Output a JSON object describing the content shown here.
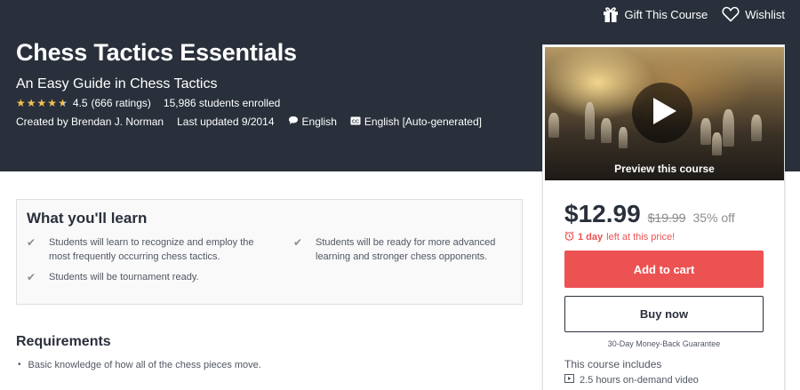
{
  "top_actions": {
    "gift_label": "Gift This Course",
    "wishlist_label": "Wishlist"
  },
  "course": {
    "title": "Chess Tactics Essentials",
    "subtitle": "An Easy Guide in Chess Tactics",
    "rating_value": "4.5",
    "rating_fraction": 0.9,
    "rating_count": "(666 ratings)",
    "enrolled": "15,986 students enrolled",
    "created_by": "Created by Brendan J. Norman",
    "last_updated": "Last updated 9/2014",
    "language": "English",
    "captions": "English [Auto-generated]"
  },
  "sidebar": {
    "preview_label": "Preview this course",
    "price": "$12.99",
    "original_price": "$19.99",
    "discount": "35% off",
    "timer_bold": "1 day",
    "timer_rest": "left at this price!",
    "add_to_cart": "Add to cart",
    "buy_now": "Buy now",
    "guarantee": "30-Day Money-Back Guarantee",
    "includes_title": "This course includes",
    "includes": [
      "2.5 hours on-demand video"
    ]
  },
  "learn": {
    "title": "What you'll learn",
    "items": [
      "Students will learn to recognize and employ the most frequently occurring chess tactics.",
      "Students will be ready for more advanced learning and stronger chess opponents.",
      "Students will be tournament ready."
    ]
  },
  "requirements": {
    "title": "Requirements",
    "items": [
      "Basic knowledge of how all of the chess pieces move."
    ]
  },
  "colors": {
    "banner": "#29303b",
    "accent_red": "#ec5252",
    "star": "#f4c150"
  }
}
